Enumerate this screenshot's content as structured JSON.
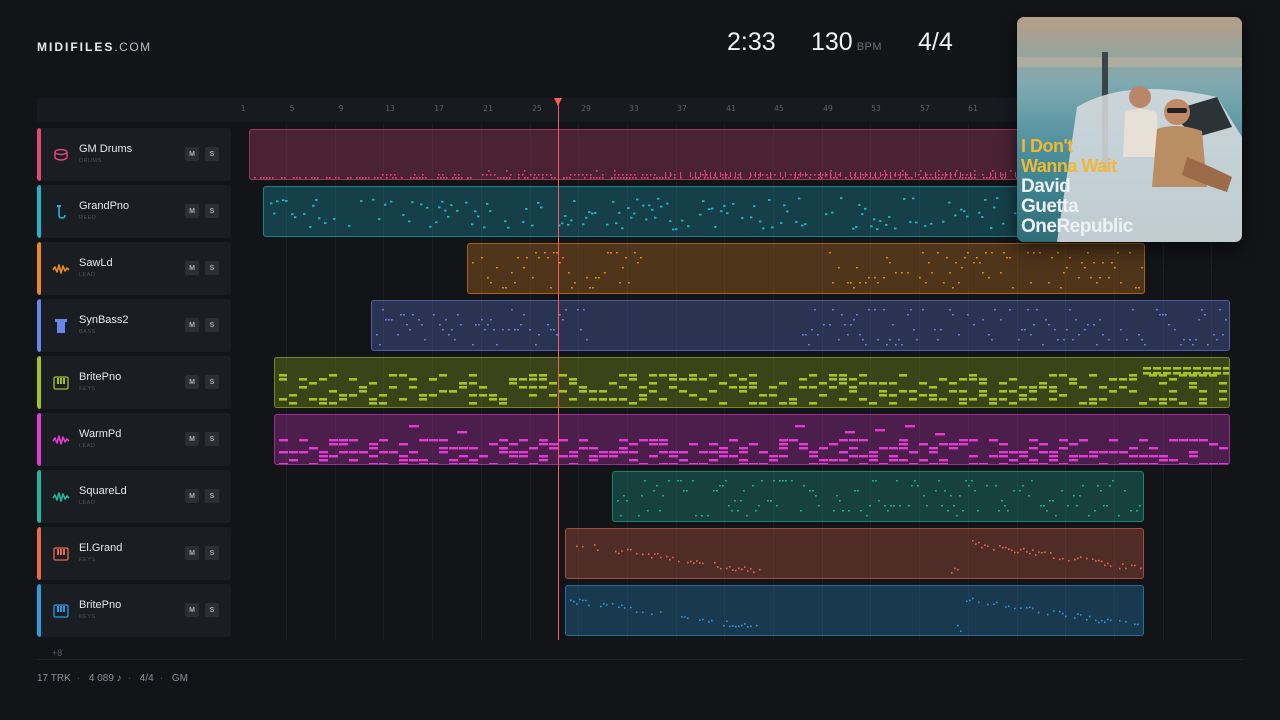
{
  "brand": {
    "name": "MIDIFILES",
    "suffix": ".COM"
  },
  "transport": {
    "time": "2:33",
    "bpm": "130",
    "bpm_unit": "BPM",
    "time_signature": "4/4"
  },
  "ruler": {
    "ticks": [
      "1",
      "5",
      "9",
      "13",
      "17",
      "21",
      "25",
      "29",
      "33",
      "37",
      "41",
      "45",
      "49",
      "53",
      "57",
      "61"
    ]
  },
  "tracks": [
    {
      "name": "GM Drums",
      "category": "DRUMS",
      "color": "#e0497a",
      "icon": "drum-icon",
      "mute": "M",
      "solo": "S"
    },
    {
      "name": "GrandPno",
      "category": "REED",
      "color": "#22b5c9",
      "icon": "saxophone-icon",
      "mute": "M",
      "solo": "S"
    },
    {
      "name": "SawLd",
      "category": "LEAD",
      "color": "#e88a1e",
      "icon": "waveform-icon",
      "mute": "M",
      "solo": "S"
    },
    {
      "name": "SynBass2",
      "category": "BASS",
      "color": "#6a86e8",
      "icon": "bass-icon",
      "mute": "M",
      "solo": "S"
    },
    {
      "name": "BritePno",
      "category": "KEYS",
      "color": "#a6c21e",
      "icon": "keyboard-icon",
      "mute": "M",
      "solo": "S"
    },
    {
      "name": "WarmPd",
      "category": "LEAD",
      "color": "#e23ad2",
      "icon": "waveform-icon",
      "mute": "M",
      "solo": "S"
    },
    {
      "name": "SquareLd",
      "category": "LEAD",
      "color": "#1fb89a",
      "icon": "waveform-icon",
      "mute": "M",
      "solo": "S"
    },
    {
      "name": "El.Grand",
      "category": "KEYS",
      "color": "#ec6a4a",
      "icon": "keyboard-icon",
      "mute": "M",
      "solo": "S"
    },
    {
      "name": "BritePno",
      "category": "KEYS",
      "color": "#2a9ce0",
      "icon": "keyboard-icon",
      "mute": "M",
      "solo": "S"
    }
  ],
  "more_tracks": "+8",
  "footer": {
    "tracks": "17 TRK",
    "notes": "4 089 ♪",
    "signature": "4/4",
    "standard": "GM"
  },
  "album": {
    "title_line1": "I Don't",
    "title_line2": "Wanna Wait",
    "artist_line1": "David",
    "artist_line2": "Guetta",
    "artist_line3": "OneRepublic"
  }
}
